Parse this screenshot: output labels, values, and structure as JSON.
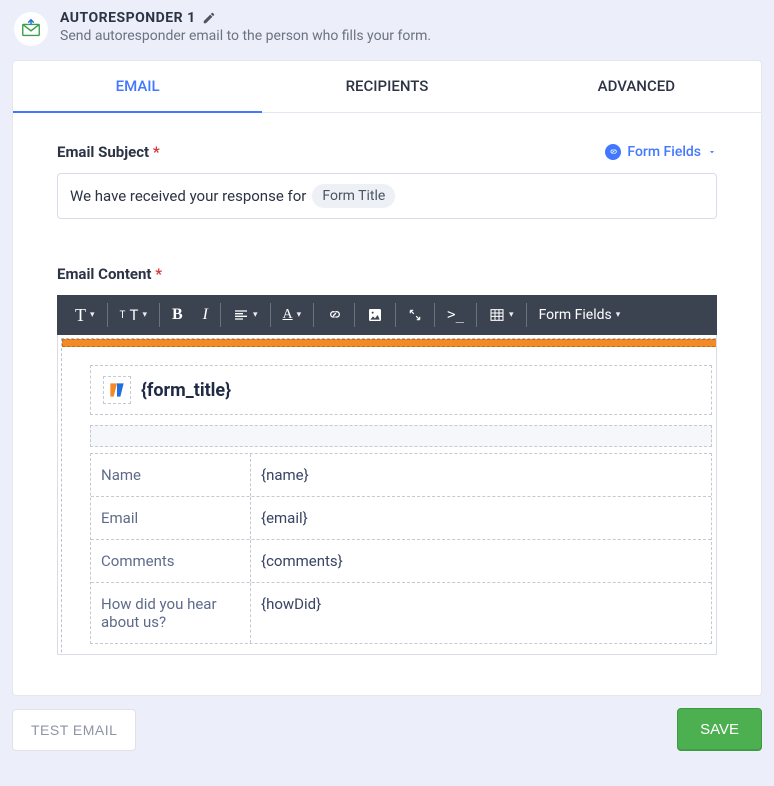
{
  "header": {
    "title": "AUTORESPONDER 1",
    "description": "Send autoresponder email to the person who fills your form."
  },
  "tabs": {
    "email": "EMAIL",
    "recipients": "RECIPIENTS",
    "advanced": "ADVANCED"
  },
  "subject": {
    "label": "Email Subject",
    "formFieldsLink": "Form Fields",
    "textBefore": "We have received your response for",
    "chip": "Form Title"
  },
  "content": {
    "label": "Email Content",
    "toolbar": {
      "formFields": "Form Fields"
    },
    "formTitlePlaceholder": "{form_title}",
    "fields": [
      {
        "label": "Name",
        "value": "{name}"
      },
      {
        "label": "Email",
        "value": "{email}"
      },
      {
        "label": "Comments",
        "value": "{comments}"
      },
      {
        "label": "How did you hear about us?",
        "value": "{howDid}"
      }
    ]
  },
  "footer": {
    "testEmail": "TEST EMAIL",
    "save": "SAVE"
  }
}
